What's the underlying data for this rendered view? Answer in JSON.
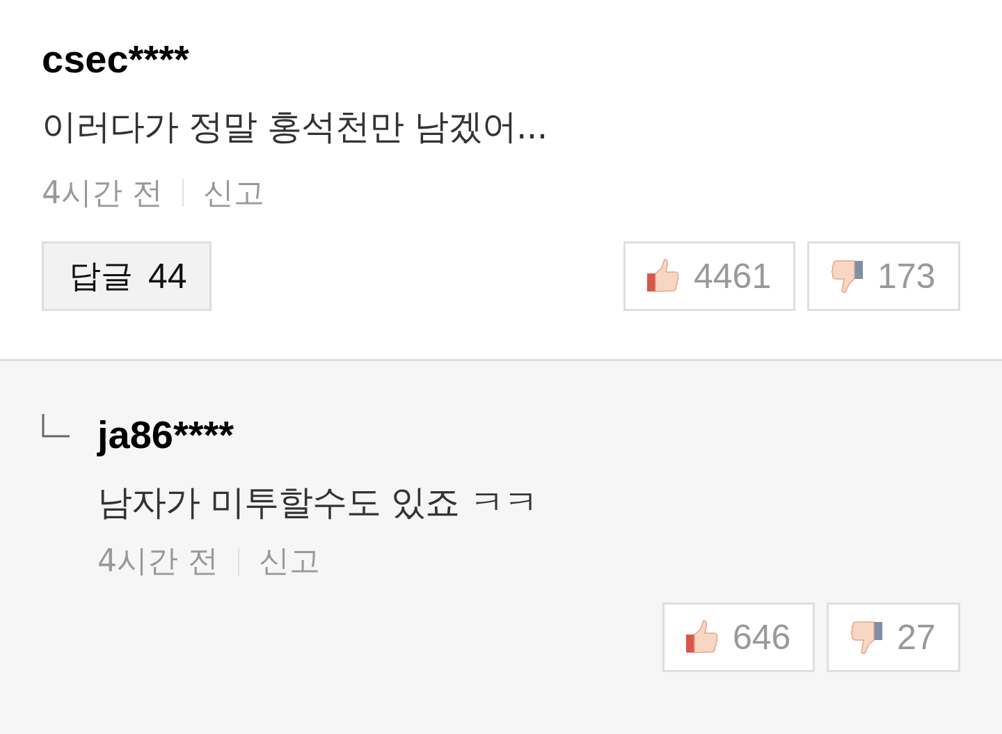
{
  "comments": [
    {
      "kind": "comment",
      "author": "csec****",
      "text": "이러다가 정말 홍석천만 남겠어...",
      "time": "4시간 전",
      "report": "신고",
      "reply_button": {
        "label": "답글",
        "count": "44"
      },
      "likes": "4461",
      "dislikes": "173"
    },
    {
      "kind": "reply",
      "author": "ja86****",
      "text": "남자가 미투할수도 있죠 ㅋㅋ",
      "time": "4시간 전",
      "report": "신고",
      "likes": "646",
      "dislikes": "27"
    }
  ]
}
